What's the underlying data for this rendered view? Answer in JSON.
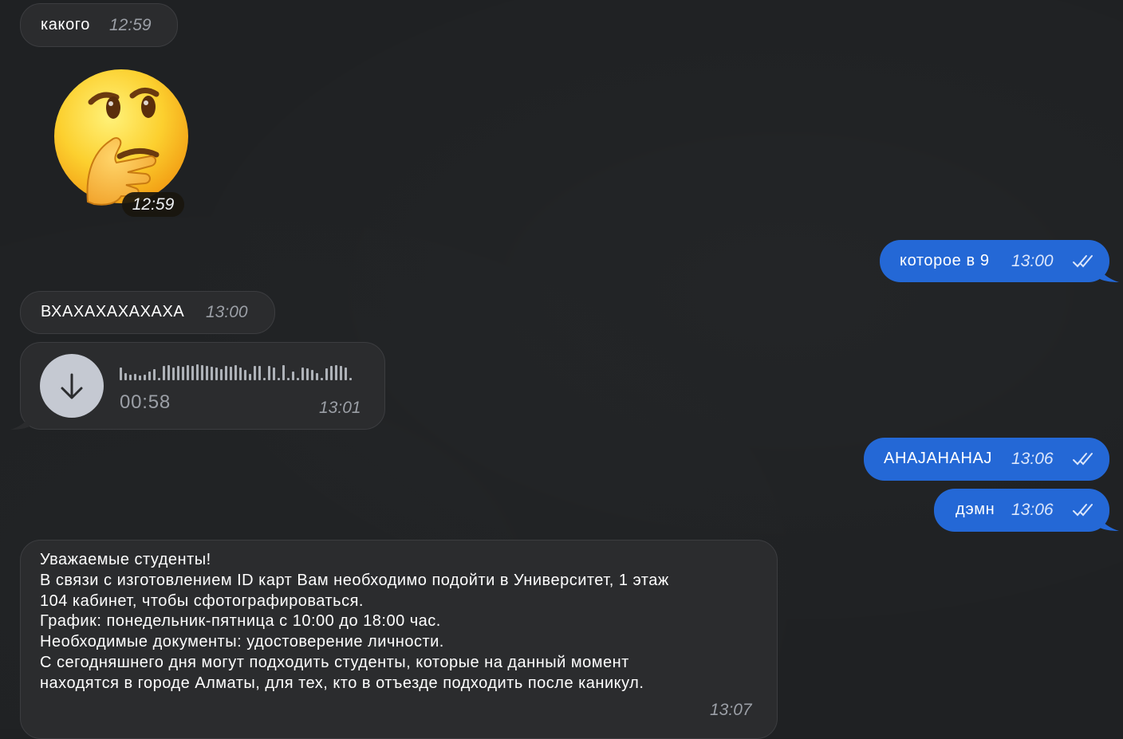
{
  "messages": {
    "m1": {
      "text": "какого",
      "time": "12:59"
    },
    "sticker": {
      "emoji": "thinking-face",
      "time": "12:59"
    },
    "m2": {
      "text": "которое в 9",
      "time": "13:00",
      "status": "read"
    },
    "m3": {
      "text": "ВХАХАХАХАХАХА",
      "time": "13:00"
    },
    "voice": {
      "duration": "00:58",
      "time": "13:01"
    },
    "m4": {
      "text": "AHAJAHAHAJ",
      "time": "13:06",
      "status": "read"
    },
    "m5": {
      "text": "дэмн",
      "time": "13:06",
      "status": "read"
    },
    "m6": {
      "lines": [
        "Уважаемые студенты!",
        "В связи с изготовлением ID карт Вам необходимо подойти в Университет, 1 этаж",
        "104 кабинет, чтобы сфотографироваться.",
        "График: понедельник-пятница с 10:00 до 18:00 час.",
        "Необходимые документы: удостоверение личности.",
        "С сегодняшнего дня могут подходить студенты, которые на данный момент",
        "находятся в городе Алматы, для тех, кто в отъезде подходить после каникул."
      ],
      "time": "13:07"
    }
  },
  "colors": {
    "background": "#1f2123",
    "incoming_bubble": "#2b2c2e",
    "outgoing_bubble": "#2468d6"
  }
}
